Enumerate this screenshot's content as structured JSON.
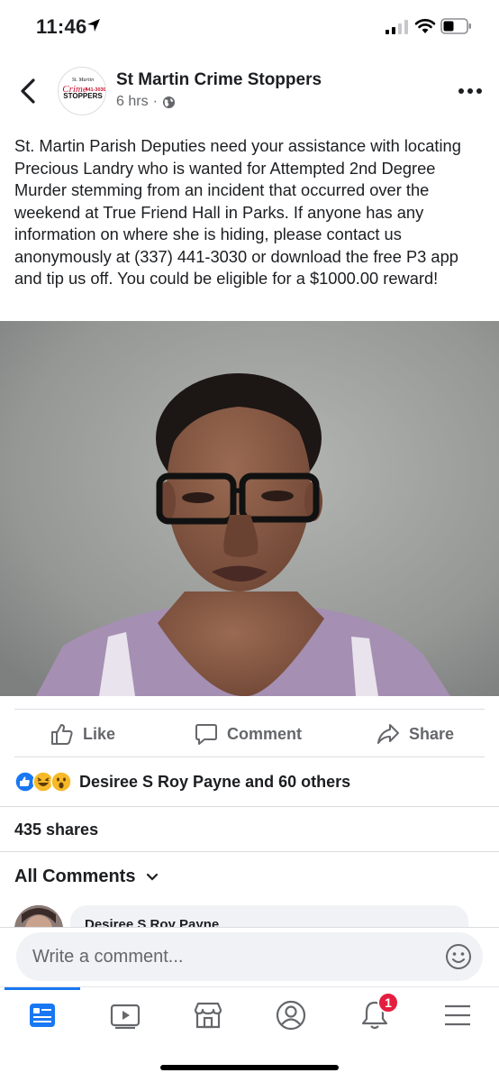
{
  "status_bar": {
    "time": "11:46"
  },
  "post": {
    "page_name": "St Martin Crime Stoppers",
    "time_ago": "6 hrs",
    "separator": "·",
    "logo_text": {
      "top": "St. Martin",
      "middle": "Crime",
      "number": "441-3030",
      "bottom": "STOPPERS"
    },
    "text": "St. Martin Parish Deputies need your assistance with locating Precious Landry who is wanted for Attempted 2nd Degree Murder stemming from an incident that occurred over the weekend at True Friend Hall in Parks. If anyone has any information on where she is hiding, please contact us anonymously at (337) 441-3030 or download the free P3 app and tip us off. You could be eligible for a $1000.00 reward!"
  },
  "actions": {
    "like": "Like",
    "comment": "Comment",
    "share": "Share"
  },
  "reactions": {
    "summary": "Desiree S Roy Payne and 60 others",
    "icons": [
      "like-icon",
      "laugh-icon",
      "wow-icon"
    ]
  },
  "shares": "435 shares",
  "comments": {
    "header": "All Comments",
    "first_author": "Desiree S Roy Payne"
  },
  "composer": {
    "placeholder": "Write a comment..."
  },
  "tabbar": {
    "notification_badge": "1",
    "items": [
      "news-feed-icon",
      "watch-icon",
      "marketplace-icon",
      "profile-icon",
      "notifications-icon",
      "menu-icon"
    ]
  },
  "colors": {
    "accent": "#1877f2",
    "badge": "#e41e3f",
    "text": "#1c1e21",
    "secondary": "#65676b"
  }
}
